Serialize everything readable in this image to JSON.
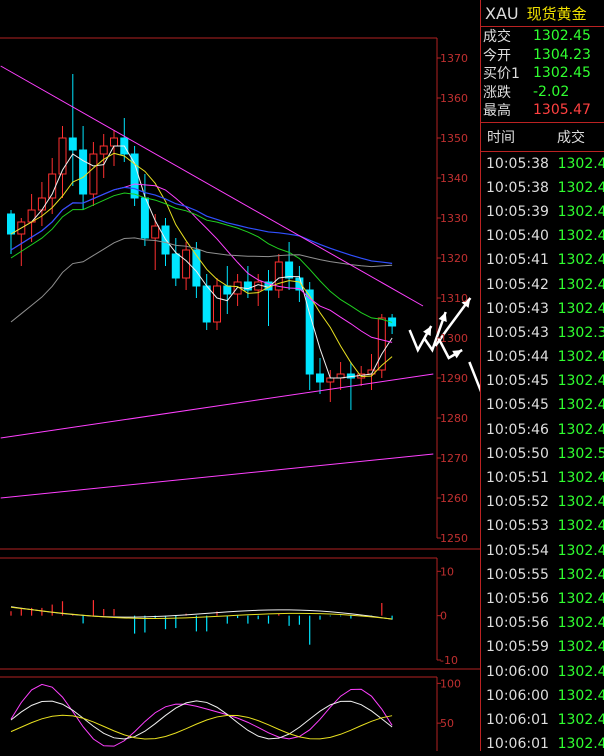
{
  "header": {
    "symbol": "XAU",
    "name": "现货黄金"
  },
  "quotes": [
    {
      "label": "成交",
      "value": "1302.45",
      "color": "green"
    },
    {
      "label": "今开",
      "value": "1304.23",
      "color": "green"
    },
    {
      "label": "买价1",
      "value": "1302.45",
      "color": "green"
    },
    {
      "label": "涨跌",
      "value": "-2.02",
      "color": "green"
    },
    {
      "label": "最高",
      "value": "1305.47",
      "color": "red"
    }
  ],
  "ticks_header": {
    "time": "时间",
    "price": "成交"
  },
  "ticks": [
    {
      "time": "10:05:38",
      "price": "1302.4"
    },
    {
      "time": "10:05:38",
      "price": "1302.4"
    },
    {
      "time": "10:05:39",
      "price": "1302.4"
    },
    {
      "time": "10:05:40",
      "price": "1302.4"
    },
    {
      "time": "10:05:41",
      "price": "1302.4"
    },
    {
      "time": "10:05:42",
      "price": "1302.4"
    },
    {
      "time": "10:05:43",
      "price": "1302.4"
    },
    {
      "time": "10:05:43",
      "price": "1302.3"
    },
    {
      "time": "10:05:44",
      "price": "1302.4"
    },
    {
      "time": "10:05:45",
      "price": "1302.4"
    },
    {
      "time": "10:05:45",
      "price": "1302.4"
    },
    {
      "time": "10:05:46",
      "price": "1302.4"
    },
    {
      "time": "10:05:50",
      "price": "1302.5"
    },
    {
      "time": "10:05:51",
      "price": "1302.4"
    },
    {
      "time": "10:05:52",
      "price": "1302.4"
    },
    {
      "time": "10:05:53",
      "price": "1302.4"
    },
    {
      "time": "10:05:54",
      "price": "1302.4"
    },
    {
      "time": "10:05:55",
      "price": "1302.4"
    },
    {
      "time": "10:05:56",
      "price": "1302.4"
    },
    {
      "time": "10:05:56",
      "price": "1302.4"
    },
    {
      "time": "10:05:59",
      "price": "1302.4"
    },
    {
      "time": "10:06:00",
      "price": "1302.4"
    },
    {
      "time": "10:06:00",
      "price": "1302.4"
    },
    {
      "time": "10:06:01",
      "price": "1302.4"
    },
    {
      "time": "10:06:01",
      "price": "1302.4"
    }
  ],
  "colors": {
    "up": "#ff3030",
    "down": "#00e5ff",
    "grid": "#b22222",
    "quote_green": "#30ff30",
    "quote_red": "#ff4040",
    "name": "#f0e000"
  },
  "chart_data": [
    {
      "type": "candlestick",
      "title": "",
      "ylim": [
        1250,
        1375
      ],
      "yticks": [
        "1370",
        "1360",
        "1350",
        "1340",
        "1330",
        "1320",
        "1310",
        "1300",
        "1290",
        "1280",
        "1270",
        "1260",
        "1250"
      ],
      "candles": [
        {
          "o": 1331,
          "h": 1332,
          "l": 1321,
          "c": 1326
        },
        {
          "o": 1326,
          "h": 1330,
          "l": 1318,
          "c": 1329
        },
        {
          "o": 1329,
          "h": 1336,
          "l": 1324,
          "c": 1332
        },
        {
          "o": 1332,
          "h": 1339,
          "l": 1328,
          "c": 1335
        },
        {
          "o": 1335,
          "h": 1345,
          "l": 1331,
          "c": 1341
        },
        {
          "o": 1341,
          "h": 1353,
          "l": 1335,
          "c": 1350
        },
        {
          "o": 1350,
          "h": 1366,
          "l": 1338,
          "c": 1347
        },
        {
          "o": 1347,
          "h": 1353,
          "l": 1332,
          "c": 1336
        },
        {
          "o": 1336,
          "h": 1349,
          "l": 1333,
          "c": 1346
        },
        {
          "o": 1346,
          "h": 1351,
          "l": 1340,
          "c": 1348
        },
        {
          "o": 1348,
          "h": 1352,
          "l": 1343,
          "c": 1350
        },
        {
          "o": 1350,
          "h": 1355,
          "l": 1344,
          "c": 1346
        },
        {
          "o": 1346,
          "h": 1348,
          "l": 1333,
          "c": 1335
        },
        {
          "o": 1335,
          "h": 1341,
          "l": 1323,
          "c": 1325
        },
        {
          "o": 1325,
          "h": 1331,
          "l": 1317,
          "c": 1328
        },
        {
          "o": 1328,
          "h": 1330,
          "l": 1318,
          "c": 1321
        },
        {
          "o": 1321,
          "h": 1325,
          "l": 1313,
          "c": 1315
        },
        {
          "o": 1315,
          "h": 1324,
          "l": 1312,
          "c": 1322
        },
        {
          "o": 1322,
          "h": 1324,
          "l": 1310,
          "c": 1313
        },
        {
          "o": 1313,
          "h": 1316,
          "l": 1302,
          "c": 1304
        },
        {
          "o": 1304,
          "h": 1315,
          "l": 1302,
          "c": 1313
        },
        {
          "o": 1313,
          "h": 1318,
          "l": 1306,
          "c": 1311
        },
        {
          "o": 1311,
          "h": 1316,
          "l": 1308,
          "c": 1314
        },
        {
          "o": 1314,
          "h": 1318,
          "l": 1310,
          "c": 1312
        },
        {
          "o": 1312,
          "h": 1316,
          "l": 1308,
          "c": 1314
        },
        {
          "o": 1314,
          "h": 1317,
          "l": 1303,
          "c": 1312
        },
        {
          "o": 1312,
          "h": 1321,
          "l": 1310,
          "c": 1319
        },
        {
          "o": 1319,
          "h": 1324,
          "l": 1312,
          "c": 1315
        },
        {
          "o": 1315,
          "h": 1318,
          "l": 1309,
          "c": 1312
        },
        {
          "o": 1312,
          "h": 1314,
          "l": 1287,
          "c": 1291
        },
        {
          "o": 1291,
          "h": 1295,
          "l": 1286,
          "c": 1289
        },
        {
          "o": 1289,
          "h": 1292,
          "l": 1284,
          "c": 1290
        },
        {
          "o": 1290,
          "h": 1294,
          "l": 1287,
          "c": 1291
        },
        {
          "o": 1291,
          "h": 1294,
          "l": 1282,
          "c": 1290
        },
        {
          "o": 1290,
          "h": 1293,
          "l": 1288,
          "c": 1291
        },
        {
          "o": 1291,
          "h": 1296,
          "l": 1287,
          "c": 1292
        },
        {
          "o": 1292,
          "h": 1306,
          "l": 1290,
          "c": 1305
        },
        {
          "o": 1305,
          "h": 1306,
          "l": 1301,
          "c": 1303
        }
      ]
    },
    {
      "type": "bar",
      "title": "",
      "ylim": [
        -10,
        13
      ],
      "yticks": [
        "10",
        "0",
        "-10"
      ]
    },
    {
      "type": "line",
      "title": "",
      "ylim": [
        15,
        108
      ],
      "yticks": [
        "100",
        "50"
      ]
    }
  ]
}
